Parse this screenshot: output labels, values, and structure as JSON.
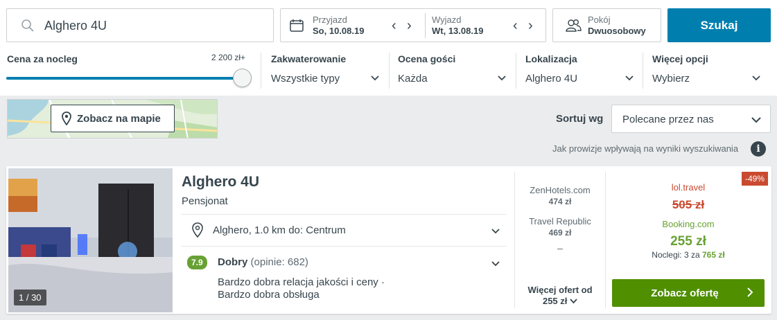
{
  "search": {
    "destination": "Alghero 4U"
  },
  "dates": {
    "checkin_label": "Przyjazd",
    "checkin_value": "So, 10.08.19",
    "checkout_label": "Wyjazd",
    "checkout_value": "Wt, 13.08.19"
  },
  "room": {
    "label": "Pokój",
    "value": "Dwuosobowy"
  },
  "search_button": "Szukaj",
  "filters": {
    "price": {
      "label": "Cena za nocleg",
      "max": "2 200 zł+",
      "level": 1.0
    },
    "accommodation": {
      "label": "Zakwaterowanie",
      "value": "Wszystkie typy"
    },
    "rating": {
      "label": "Ocena gości",
      "value": "Każda"
    },
    "location": {
      "label": "Lokalizacja",
      "value": "Alghero 4U"
    },
    "more": {
      "label": "Więcej opcji",
      "value": "Wybierz"
    }
  },
  "map_button": "Zobacz na mapie",
  "sort": {
    "label": "Sortuj wg",
    "value": "Polecane przez nas"
  },
  "info_line": "Jak prowizje wpływają na wyniki wyszukiwania",
  "result": {
    "name": "Alghero 4U",
    "type": "Pensjonat",
    "photo_count": "1 / 30",
    "location": "Alghero, 1.0 km do: Centrum",
    "rating_score": "7.9",
    "rating_word": "Dobry",
    "rating_count": "(opinie: 682)",
    "review_1": "Bardzo dobra relacja jakości i ceny ·",
    "review_2": "Bardzo dobra obsługa",
    "providers": [
      {
        "name": "ZenHotels.com",
        "price": "474 zł"
      },
      {
        "name": "Travel Republic",
        "price": "469 zł"
      }
    ],
    "dash": "–",
    "more_offers_1": "Więcej ofert od",
    "more_offers_2": "255 zł",
    "discount": "-49%",
    "old_provider": "lol.travel",
    "old_price": "505 zł",
    "best_provider": "Booking.com",
    "best_price": "255 zł",
    "nights_prefix": "Noclegi: 3 za",
    "nights_total": "765 zł",
    "deal_button": "Zobacz ofertę"
  },
  "colors": {
    "accent": "#007faf",
    "deal_green": "#4f8f00",
    "rating_green": "#67a133",
    "discount_red": "#c94a30"
  }
}
